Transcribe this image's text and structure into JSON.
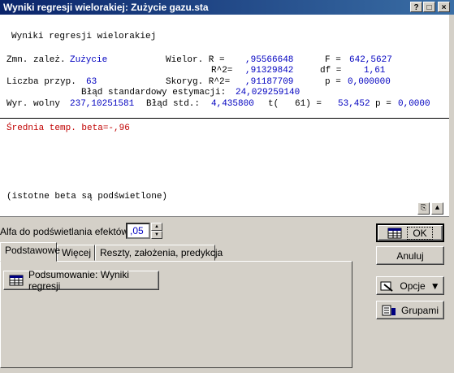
{
  "window": {
    "title": "Wyniki regresji wielorakiej: Zużycie gazu.sta",
    "help_btn": "?",
    "max_btn": "□",
    "close_btn": "×"
  },
  "results": {
    "heading": "Wyniki regresji wielorakiej",
    "row1": {
      "dep_label": "Zmn. zależ.",
      "dep_value": "Zużycie",
      "r_label": "Wielor. R =",
      "r_value": ",95566648",
      "f_label": "F =",
      "f_value": "642,5627"
    },
    "row2": {
      "r2_label": "R^2=",
      "r2_value": ",91329842",
      "df_label": "df =",
      "df_value": "1,61"
    },
    "row3": {
      "n_label": "Liczba przyp.",
      "n_value": "63",
      "adj_label": "Skoryg. R^2=",
      "adj_value": ",91187709",
      "p_label": "p =",
      "p_value": "0,000000"
    },
    "row4": {
      "se_label": "Błąd standardowy estymacji:",
      "se_value": "24,029259140"
    },
    "row5": {
      "int_label": "Wyr. wolny",
      "int_value": "237,10251581",
      "std_label": "Błąd std.:",
      "std_value": "4,435800",
      "t_label": "t(   61) =",
      "t_value": "53,452",
      "p_label": "p =",
      "p_value": "0,0000"
    },
    "beta_line": "Średnia temp. beta=-,96",
    "note": "(istotne beta są podświetlone)"
  },
  "controls": {
    "alfa_label": "Alfa do podświetlania efektów:",
    "alfa_value": ",05",
    "tabs": [
      "Podstawowe",
      "Więcej",
      "Reszty, założenia, predykcja"
    ],
    "summary_button": "Podsumowanie:  Wyniki regresji",
    "ok_button": "OK",
    "cancel_button": "Anuluj",
    "options_button": "Opcje",
    "groups_button": "Grupami"
  }
}
